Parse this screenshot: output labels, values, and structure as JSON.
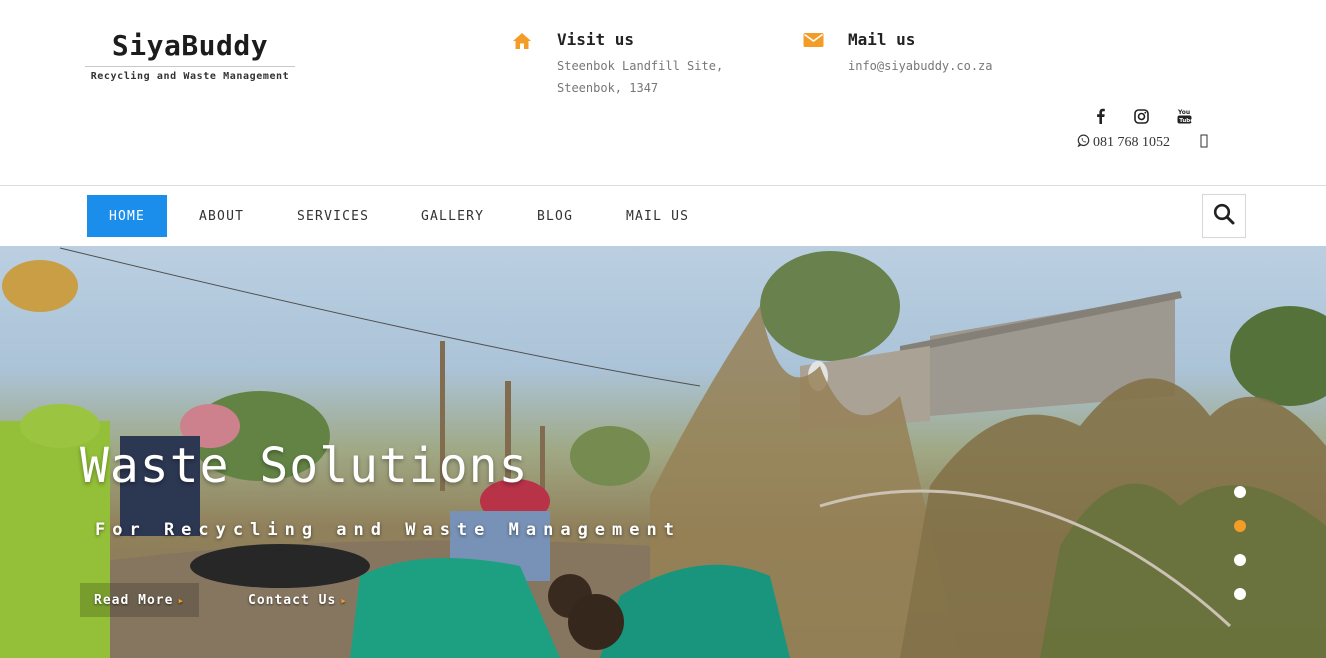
{
  "header": {
    "brand": "SiyaBuddy",
    "tagline": "Recycling and Waste Management",
    "visit": {
      "title": "Visit us",
      "line1": "Steenbok Landfill Site,",
      "line2": "Steenbok, 1347",
      "icon": "home-icon"
    },
    "mail": {
      "title": "Mail us",
      "line1": "info@siyabuddy.co.za",
      "icon": "envelope-icon"
    },
    "social": [
      "facebook-icon",
      "instagram-icon",
      "youtube-icon"
    ],
    "phone": "081 768 1052",
    "accent": "#f39c27"
  },
  "nav": {
    "items": [
      {
        "label": "HOME",
        "active": true
      },
      {
        "label": "ABOUT"
      },
      {
        "label": "SERVICES"
      },
      {
        "label": "GALLERY"
      },
      {
        "label": "BLOG"
      },
      {
        "label": "MAIL US"
      }
    ],
    "active_color": "#1b8eec",
    "search_icon": "search-icon"
  },
  "hero": {
    "title": "Waste Solutions",
    "subtitle": "For Recycling and Waste Management",
    "buttons": [
      "Read More",
      "Contact Us"
    ],
    "slides": 4,
    "active_slide": 2
  }
}
